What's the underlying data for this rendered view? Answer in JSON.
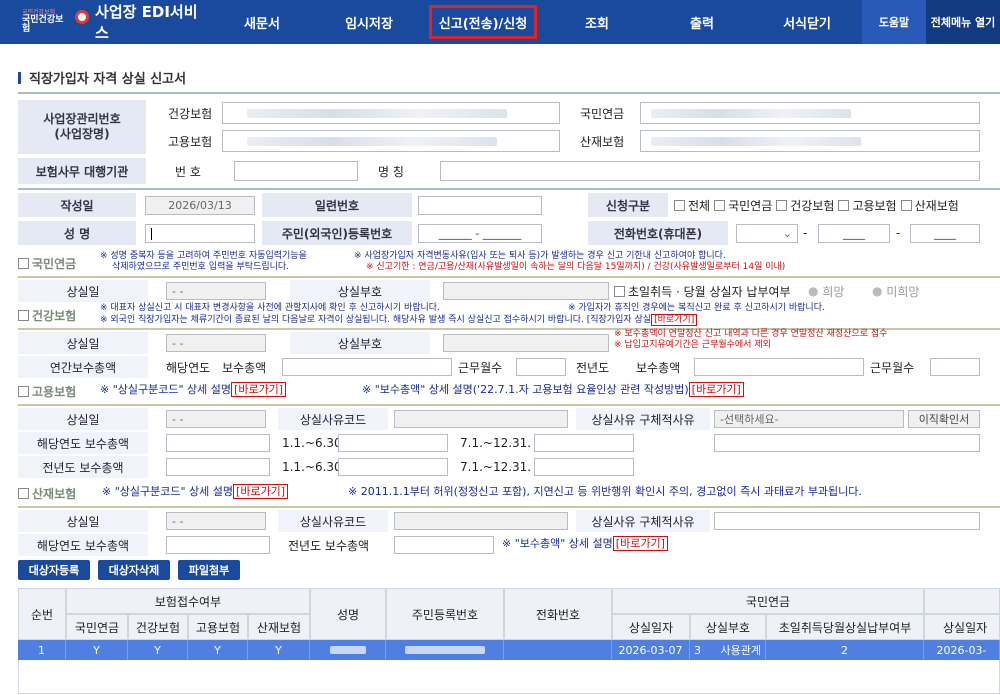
{
  "nav": {
    "brand_small": "국민건강보험",
    "brand_org": "국민건강보험",
    "brand_title": "사업장 EDI서비스",
    "items": [
      "새문서",
      "임시저장",
      "신고(전송)/신청",
      "조회",
      "출력",
      "서식닫기"
    ],
    "help": "도움말",
    "all_menu": "전체메뉴 열기"
  },
  "page_title": "직장가입자 자격 상실 신고서",
  "biz": {
    "mgmt_label": "사업장관리번호\n(사업장명)",
    "health": "건강보험",
    "employment": "고용보험",
    "pension": "국민연금",
    "industrial": "산재보험",
    "agency_label": "보험사무 대행기관",
    "number_label": "번 호",
    "name_label": "명 칭"
  },
  "form": {
    "date_label": "작성일",
    "date_value": "2026/03/13",
    "serial_label": "일련번호",
    "apply_label": "신청구분",
    "apply_options": [
      "전체",
      "국민연금",
      "건강보험",
      "고용보험",
      "산재보험"
    ],
    "name_label": "성 명",
    "rrn_label": "주민(외국인)등록번호",
    "rrn_value": "______ - _______",
    "phone_label": "전화번호(휴대폰)",
    "phone_sep": "-",
    "phone_mid": "____",
    "phone_last": "____"
  },
  "pension": {
    "title": "국민연금",
    "note1": "※ 성명 중복자 등을 고려하여 주민번호 자동입력기능을",
    "note2": "삭제하였으므로 주민번호 입력을 부탁드립니다.",
    "note3": "※ 사업장가입자 자격변동사유(입사 또는 퇴사 등)가 발생하는 경우 신고 기한내 신고하여야 합니다.",
    "note4": "※ 신고기한 : 연금/고용/산재(사유발생일이 속하는 달의 다음달 15일까지) / 건강(사유발생일로부터 14일 이내)",
    "loss_date": "상실일",
    "loss_code": "상실부호",
    "first_month": "초일취득 · 당월 상실자 납부여부",
    "hope": "희망",
    "no_hope": "미희망",
    "date_placeholder": "- -"
  },
  "health": {
    "title": "건강보험",
    "note1": "※ 대표자 상실신고 시 대표자 변경사항을 사전에 관할지사에 확인 후 신고하시기 바랍니다.",
    "note2": "※ 가입자가 휴직인 경우에는 복직신고 완료 후 신고하시기 바랍니다.",
    "note3": "※ 외국인 직장가입자는 체류기간이 종료된 날의 다음날로 자격이 상실됩니다. 해당사유 발생 즉시 상실신고 접수하시기 바랍니다. [직장가입자 상실",
    "note4": "※ 보수총액이 연말정산 신고 내역과 다른 경우 연말정산 재정산으로 접수",
    "note5": "※ 납입고지유예기간은 근무월수에서 제외",
    "link": "[바로가기]",
    "loss_date": "상실일",
    "loss_code": "상실부호",
    "annual_pay": "연간보수총액",
    "cur_year": "해당연도",
    "pay_total": "보수총액",
    "work_months": "근무월수",
    "prev_year": "전년도"
  },
  "employment": {
    "title": "고용보험",
    "note1": "※ \"상실구분코드\" 상세 설명",
    "note2": "※ \"보수총액\" 상세 설명('22.7.1.자 고용보험 요율인상 관련 작성방법)",
    "link": "[바로가기]",
    "loss_date": "상실일",
    "reason_code": "상실사유코드",
    "reason_detail": "상실사유 구체적사유",
    "select_placeholder": "-선택하세요-",
    "confirm_btn": "이직확인서",
    "cur_pay": "해당연도 보수총액",
    "prev_pay": "전년도 보수총액",
    "period1": "1.1.~6.30.",
    "period2": "7.1.~12.31."
  },
  "industrial": {
    "title": "산재보험",
    "note1": "※ \"상실구분코드\" 상세 설명",
    "note2": "※ 2011.1.1부터 허위(정정신고 포함), 지연신고 등 위반행위 확인시 주의, 경고없이 즉시 과태료가 부과됩니다.",
    "note3": "※ \"보수총액\" 상세 설명",
    "link": "[바로가기]",
    "loss_date": "상실일",
    "reason_code": "상실사유코드",
    "reason_detail": "상실사유 구체적사유",
    "cur_pay": "해당연도 보수총액",
    "prev_pay": "전년도 보수총액"
  },
  "buttons": {
    "add": "대상자등록",
    "delete": "대상자삭제",
    "attach": "파일첨부"
  },
  "table": {
    "seq": "순번",
    "receipt": "보험접수여부",
    "pension": "국민연금",
    "health": "건강보험",
    "employment": "고용보험",
    "industrial": "산재보험",
    "name": "성명",
    "rrn": "주민등록번호",
    "phone": "전화번호",
    "pension_group": "국민연금",
    "loss_date": "상실일자",
    "loss_code": "상실부호",
    "first_month": "초일취득당월상실납부여부",
    "loss_date2": "상실일자",
    "row": {
      "seq": "1",
      "p": "Y",
      "h": "Y",
      "e": "Y",
      "i": "Y",
      "date": "2026-03-07",
      "code": "3",
      "code_text": "사용관계",
      "first": "2",
      "date2": "2026-03-"
    }
  },
  "colors": {
    "nav_bg": "#1a4a9e",
    "active_border": "#e52222",
    "row_selected": "#4f7fe0"
  }
}
